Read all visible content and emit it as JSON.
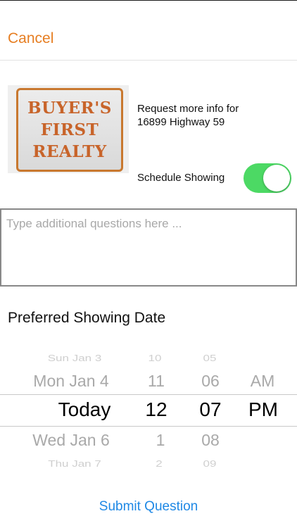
{
  "nav": {
    "cancel_label": "Cancel"
  },
  "logo": {
    "lines": [
      "BUYER'S",
      "FIRST",
      "REALTY"
    ]
  },
  "info": {
    "line1": "Request more info for",
    "line2": "16899 Highway 59"
  },
  "schedule": {
    "label": "Schedule Showing",
    "enabled": true,
    "on_color": "#4cd964"
  },
  "questions": {
    "placeholder": "Type additional questions here ...",
    "value": ""
  },
  "date": {
    "heading": "Preferred Showing Date",
    "days": [
      "Sun Jan 3",
      "Mon Jan 4",
      "Today",
      "Wed Jan 6",
      "Thu Jan 7"
    ],
    "hours": [
      "10",
      "11",
      "12",
      "1",
      "2"
    ],
    "minutes": [
      "05",
      "06",
      "07",
      "08",
      "09"
    ],
    "periods": [
      "",
      "AM",
      "PM",
      "",
      ""
    ]
  },
  "submit": {
    "label": "Submit Question",
    "color": "#1e88e5"
  },
  "colors": {
    "accent": "#e67e22"
  }
}
